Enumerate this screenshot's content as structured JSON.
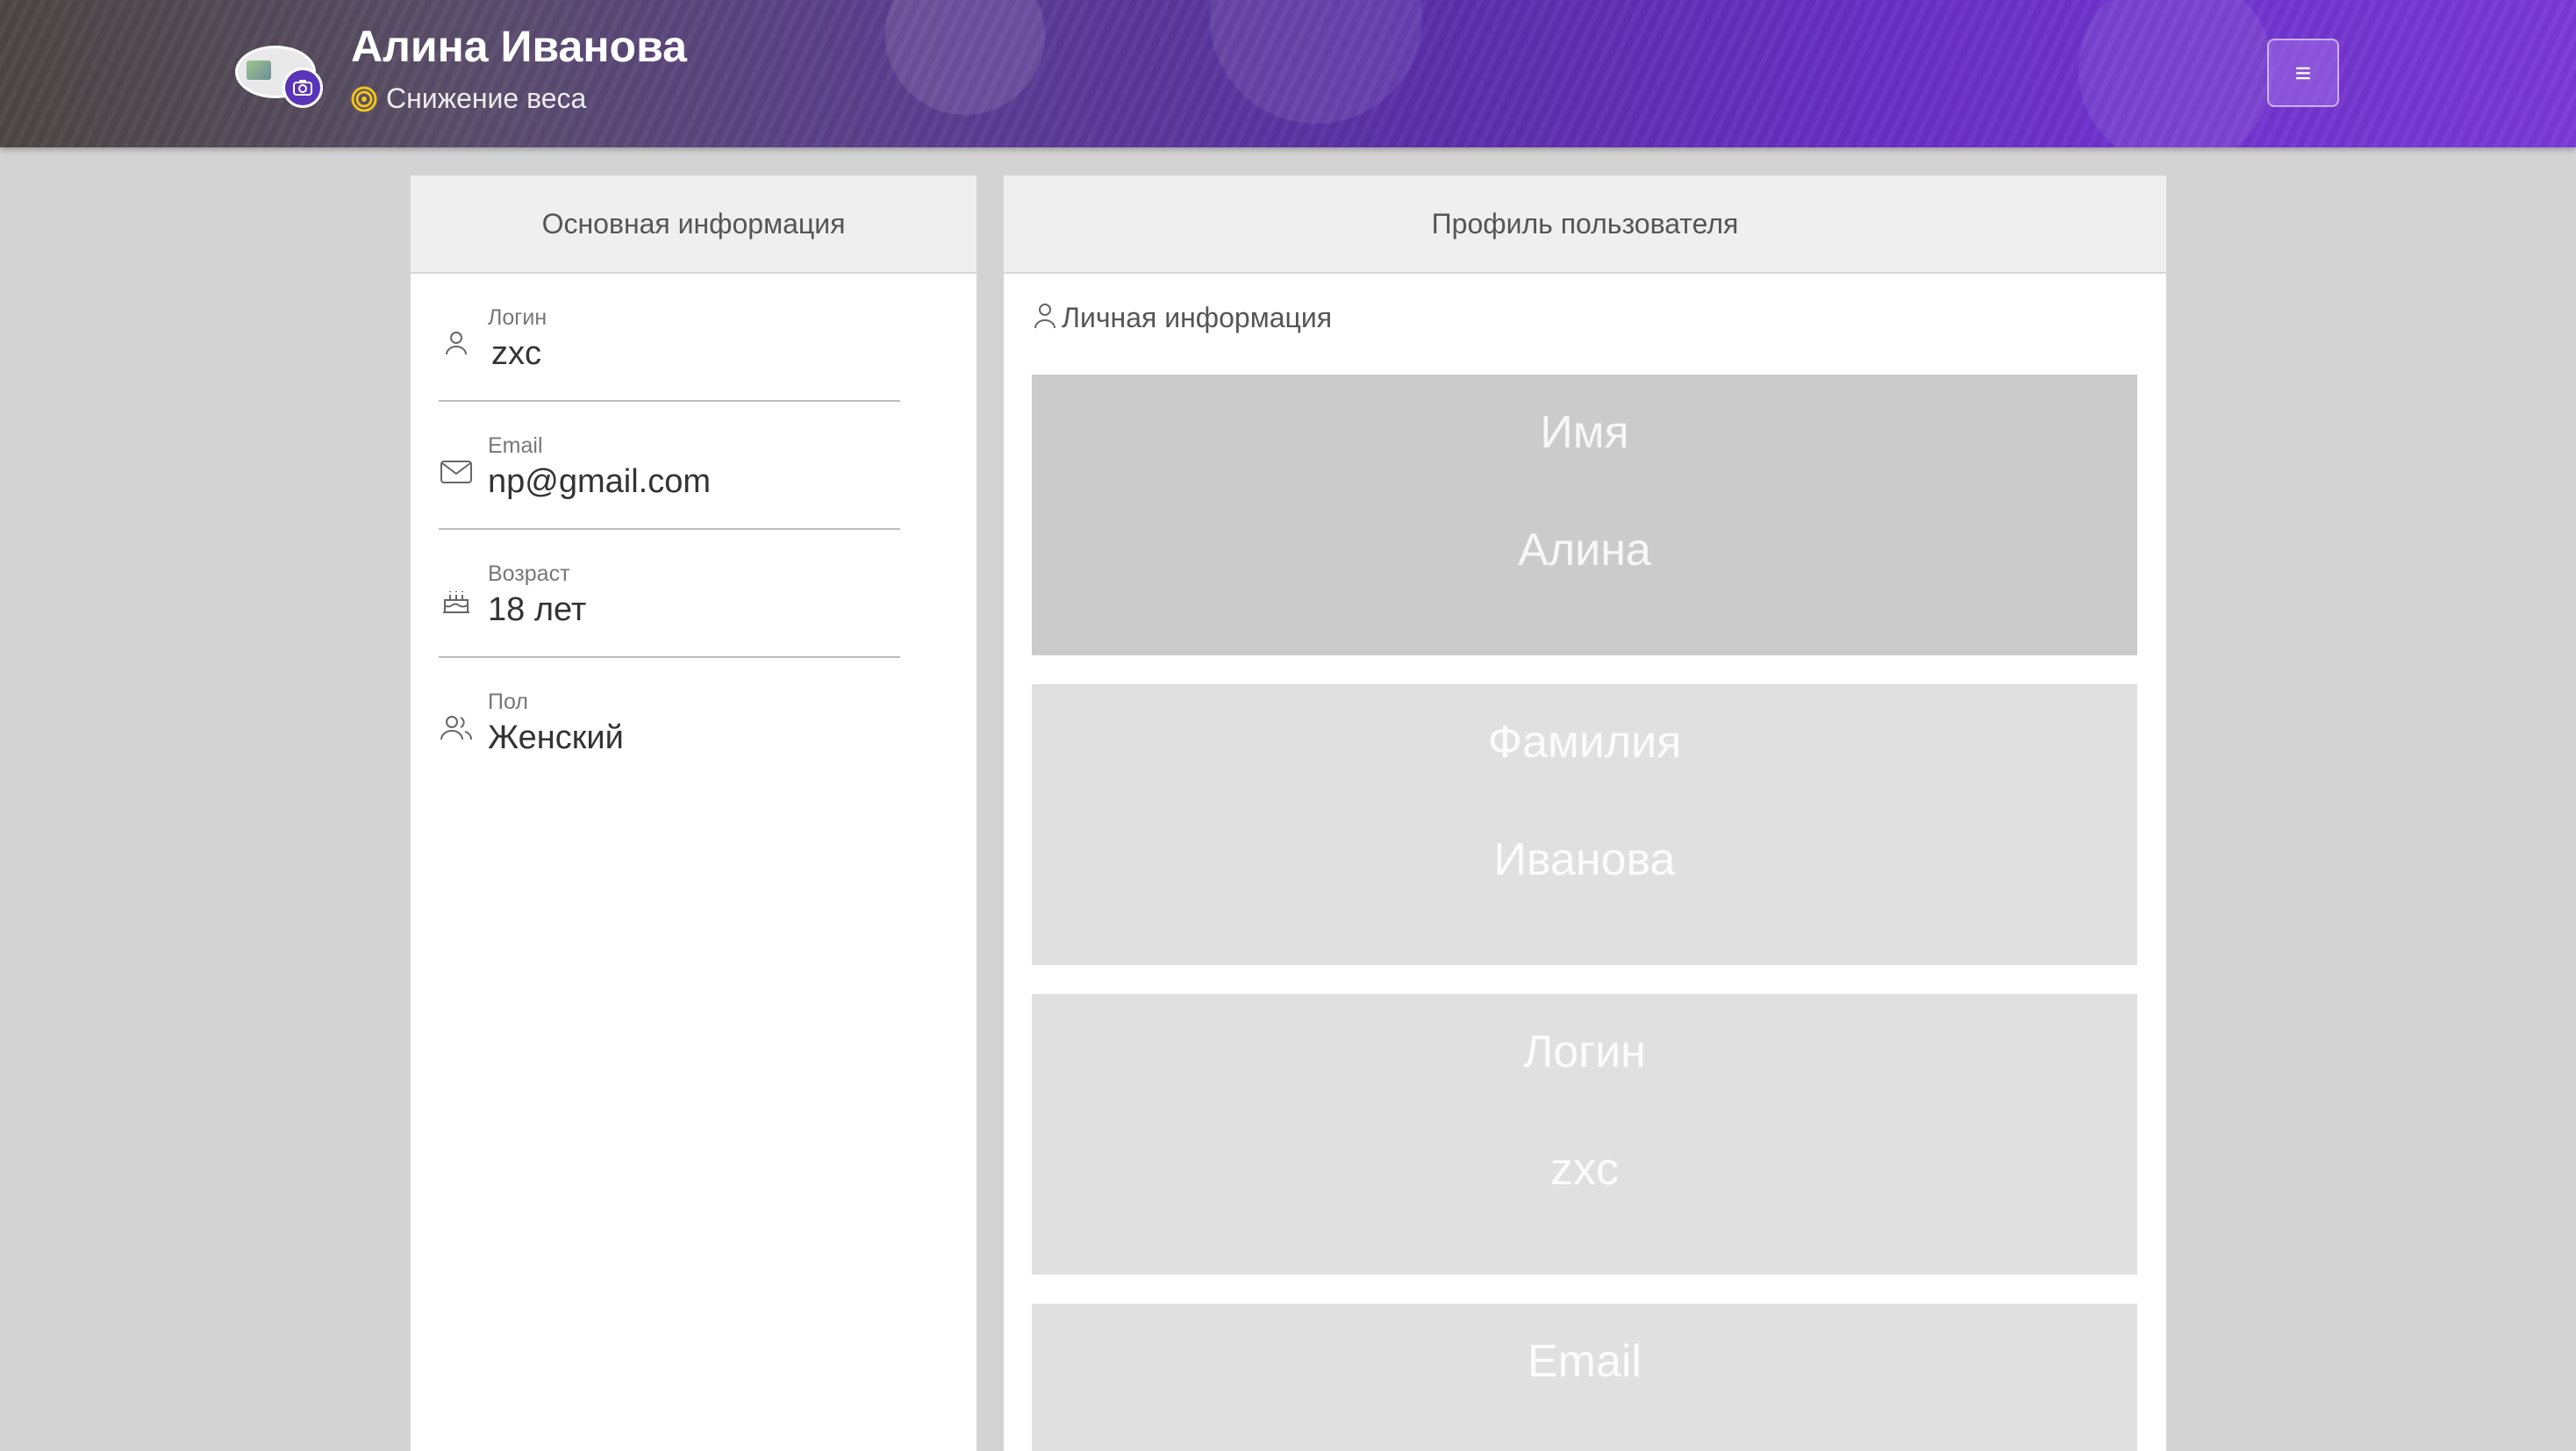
{
  "header": {
    "user_name": "Алина Иванова",
    "goal": "Снижение веса",
    "avatar_alt": "zxc",
    "menu_icon": "≡"
  },
  "left_card": {
    "title": "Основная информация",
    "rows": [
      {
        "label": "Логин",
        "value": "zxc",
        "icon": "user-icon"
      },
      {
        "label": "Email",
        "value": "np@gmail.com",
        "icon": "mail-icon"
      },
      {
        "label": "Возраст",
        "value": "18 лет",
        "icon": "cake-icon"
      },
      {
        "label": "Пол",
        "value": "Женский",
        "icon": "users-icon"
      }
    ]
  },
  "right_card": {
    "title": "Профиль пользователя",
    "section_title": "Личная информация",
    "fields": [
      {
        "label": "Имя",
        "value": "Алина"
      },
      {
        "label": "Фамилия",
        "value": "Иванова"
      },
      {
        "label": "Логин",
        "value": "zxc"
      },
      {
        "label": "Email",
        "value": ""
      }
    ]
  },
  "colors": {
    "accent": "#5b35b8",
    "goal_icon": "#f0c419",
    "background": "#d3d3d3"
  }
}
